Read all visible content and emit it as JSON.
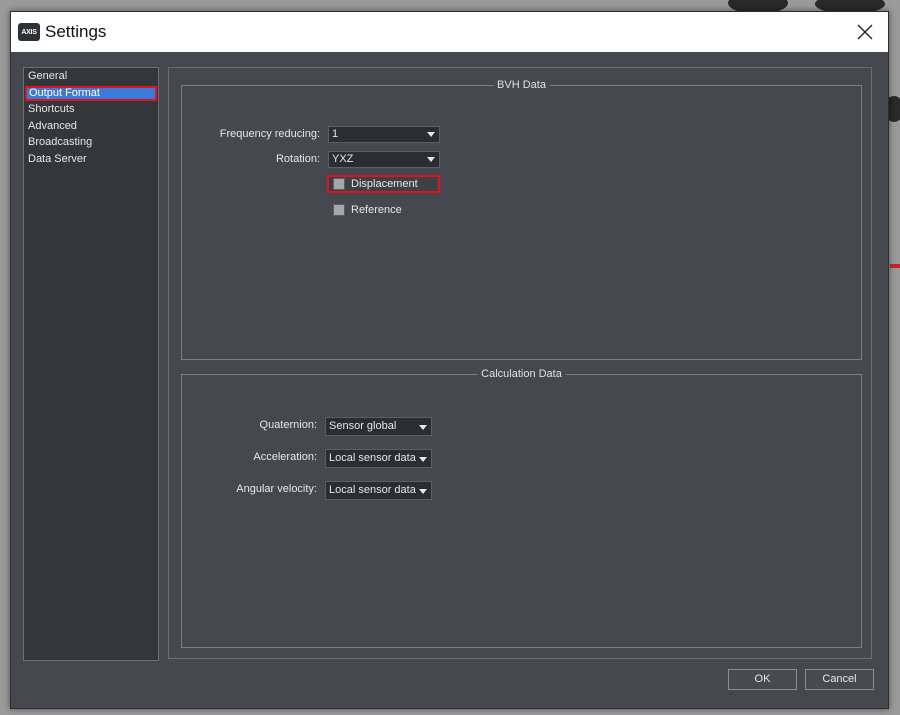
{
  "window": {
    "title": "Settings",
    "logo_text": "AXIS"
  },
  "sidebar": {
    "items": [
      {
        "label": "General"
      },
      {
        "label": "Output Format"
      },
      {
        "label": "Shortcuts"
      },
      {
        "label": "Advanced"
      },
      {
        "label": "Broadcasting"
      },
      {
        "label": "Data Server"
      }
    ],
    "selected": "Output Format"
  },
  "bvh": {
    "title": "BVH Data",
    "frequency_label": "Frequency reducing:",
    "frequency_value": "1",
    "rotation_label": "Rotation:",
    "rotation_value": "YXZ",
    "displacement_label": "Displacement",
    "displacement_checked": false,
    "reference_label": "Reference",
    "reference_checked": false
  },
  "calc": {
    "title": "Calculation Data",
    "quaternion_label": "Quaternion:",
    "quaternion_value": "Sensor global",
    "acceleration_label": "Acceleration:",
    "acceleration_value": "Local sensor data",
    "angular_label": "Angular velocity:",
    "angular_value": "Local sensor data"
  },
  "buttons": {
    "ok": "OK",
    "cancel": "Cancel"
  },
  "colors": {
    "accent": "#3b7ad8",
    "highlight": "#e0141e",
    "panel": "#45494f"
  }
}
